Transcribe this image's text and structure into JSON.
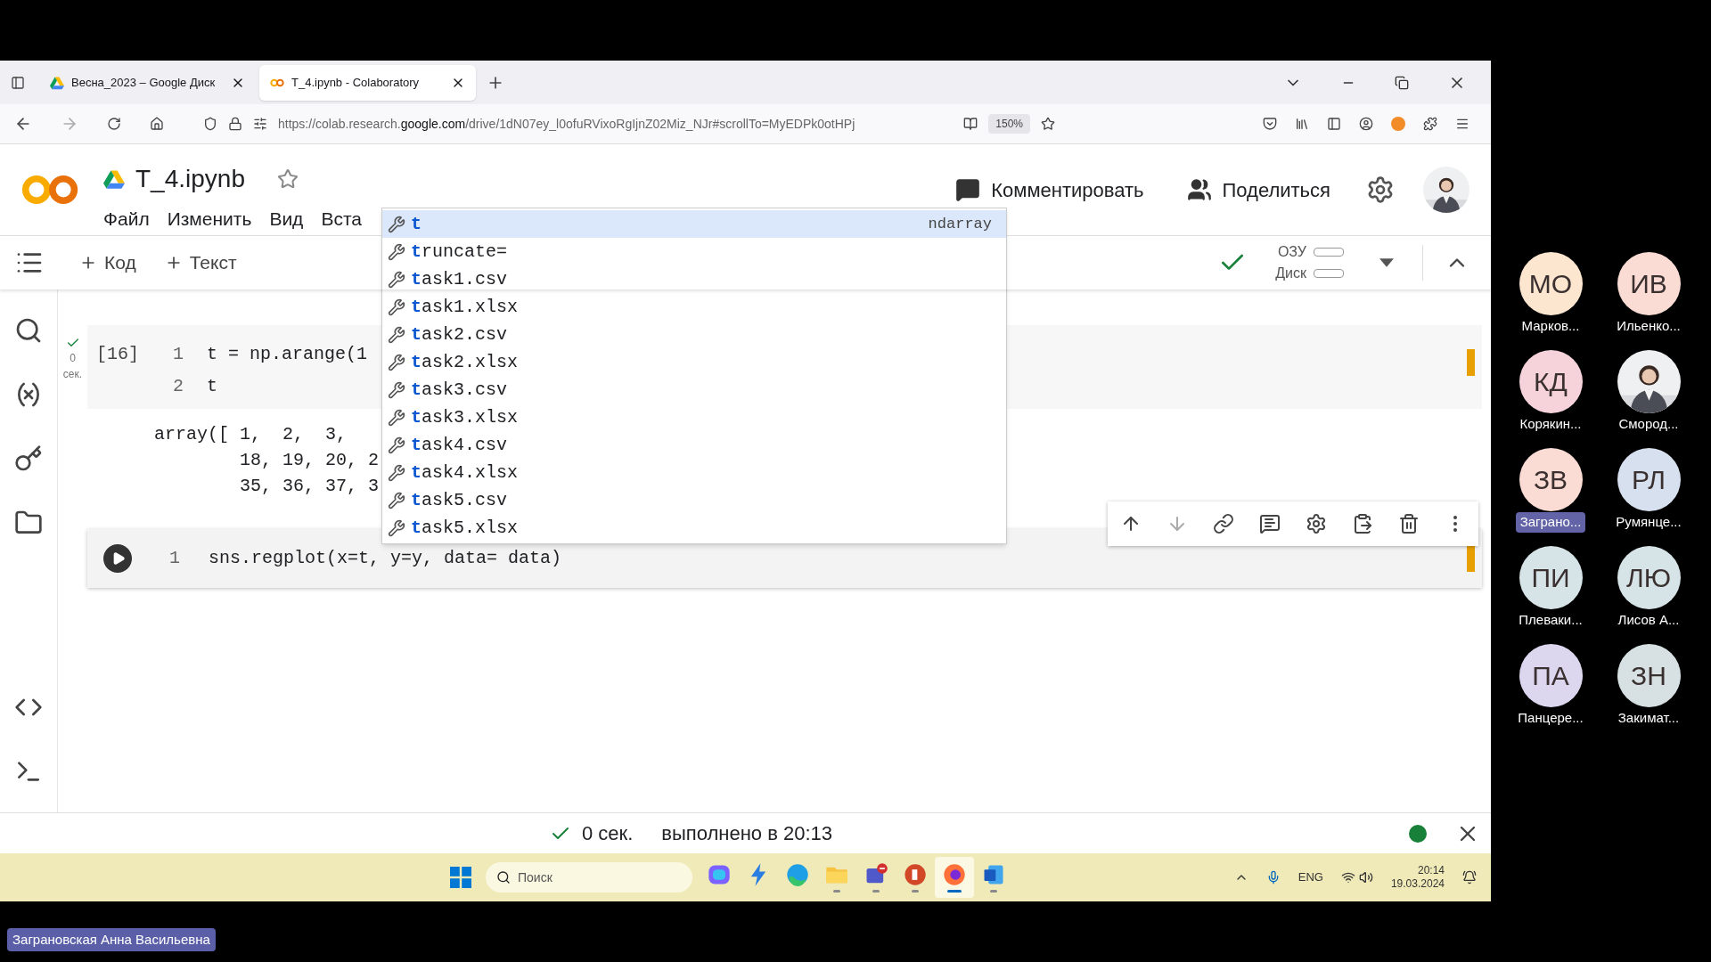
{
  "browser": {
    "tabs": [
      {
        "title": "Весна_2023 – Google Диск",
        "kind": "drive",
        "selected": false
      },
      {
        "title": "T_4.ipynb - Colaboratory",
        "kind": "colab",
        "selected": true
      }
    ],
    "url": "https://colab.research.**google.com**/drive/1dN07ey_l0ofuRVixoRgIjnZ02Miz_NJr#scrollTo=MyEDPk0otHPj",
    "zoom": "150%"
  },
  "notebook": {
    "title": "T_4.ipynb",
    "menu": [
      "Файл",
      "Изменить",
      "Вид",
      "Вста"
    ],
    "comment": "Комментировать",
    "share": "Поделиться",
    "toolbar": {
      "add_code": "Код",
      "add_text": "Текст",
      "ram": "ОЗУ",
      "disk": "Диск"
    }
  },
  "cells": [
    {
      "kind": "done",
      "exec_count": "[16]",
      "time": "0",
      "time_unit": "сек.",
      "lines": [
        {
          "number": "1",
          "code": "t = np.arange(1"
        },
        {
          "number": "2",
          "code": "t"
        }
      ],
      "output": [
        "array([ 1,  2,  3,",
        "        18, 19, 20, 2",
        "        35, 36, 37, 3"
      ]
    },
    {
      "kind": "active",
      "lines": [
        {
          "number": "1",
          "code": "sns.regplot(x=t, y=y, data= data)"
        }
      ]
    }
  ],
  "autocomplete": [
    {
      "text": "**t**",
      "type": "ndarray",
      "selected": true
    },
    {
      "text": "**t**runcate=",
      "selected": false
    },
    {
      "text": "**t**ask1.csv",
      "selected": false
    },
    {
      "text": "**t**ask1.xlsx",
      "selected": false
    },
    {
      "text": "**t**ask2.csv",
      "selected": false
    },
    {
      "text": "**t**ask2.xlsx",
      "selected": false
    },
    {
      "text": "**t**ask3.csv",
      "selected": false
    },
    {
      "text": "**t**ask3.xlsx",
      "selected": false
    },
    {
      "text": "**t**ask4.csv",
      "selected": false
    },
    {
      "text": "**t**ask4.xlsx",
      "selected": false
    },
    {
      "text": "**t**ask5.csv",
      "selected": false
    },
    {
      "text": "**t**ask5.xlsx",
      "selected": false
    }
  ],
  "status_bar": {
    "duration": "0 сек.",
    "message": "выполнено в 20:13"
  },
  "taskbar": {
    "search": "Поиск",
    "apps": [
      {
        "kind": "copilot",
        "running": false,
        "active": false
      },
      {
        "kind": "bolt",
        "running": false,
        "active": false
      },
      {
        "kind": "edge",
        "running": false,
        "active": false
      },
      {
        "kind": "folder",
        "running": true,
        "active": false
      },
      {
        "kind": "teams",
        "running": true,
        "active": false
      },
      {
        "kind": "slides",
        "running": true,
        "active": false
      },
      {
        "kind": "firefox",
        "running": true,
        "active": true
      },
      {
        "kind": "word",
        "running": true,
        "active": false
      }
    ],
    "language": "ENG",
    "time": "20:14",
    "date": "19.03.2024"
  },
  "participants": [
    {
      "initials": "МО",
      "name": "Марков...",
      "color": "#fce6cf",
      "speaking": false
    },
    {
      "initials": "ИВ",
      "name": "Ильенко...",
      "color": "#fbdcd5",
      "speaking": false
    },
    {
      "initials": "КД",
      "name": "Корякин...",
      "color": "#f6d3db",
      "speaking": false
    },
    {
      "kind": "picture",
      "name": "Смород...",
      "speaking": false
    },
    {
      "initials": "ЗВ",
      "name": "Заграно...",
      "color": "#fbdcd5",
      "speaking": true
    },
    {
      "initials": "РЛ",
      "name": "Румянце...",
      "color": "#d6e0ef",
      "speaking": false
    },
    {
      "initials": "ПИ",
      "name": "Плеваки...",
      "color": "#d6e3e7",
      "speaking": false
    },
    {
      "initials": "ЛЮ",
      "name": "Лисов А...",
      "color": "#d6e3e7",
      "speaking": false
    },
    {
      "initials": "ПА",
      "name": "Панцере...",
      "color": "#dcd7ef",
      "speaking": false
    },
    {
      "initials": "ЗН",
      "name": "Закимат...",
      "color": "#d7e1e3",
      "speaking": false
    }
  ],
  "presenter": "Заграновская Анна Васильевна"
}
